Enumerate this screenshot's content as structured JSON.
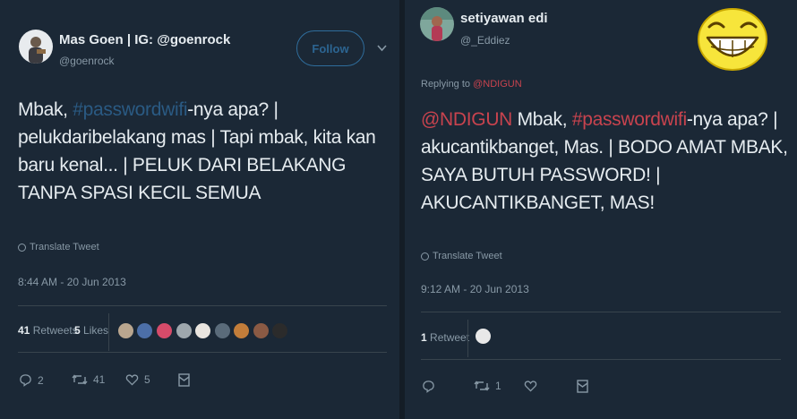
{
  "tweets": [
    {
      "name": "Mas Goen | IG: @goenrock",
      "handle": "@goenrock",
      "follow_label": "Follow",
      "text_part1": "Mbak, ",
      "hashtag": "#passwordwifi",
      "text_part2": "-nya apa? | pelukdaribelakang mas | Tapi mbak, kita kan baru kenal... | PELUK DARI BELAKANG TANPA SPASI KECIL SEMUA",
      "translate": "Translate Tweet",
      "timestamp": "8:44 AM - 20 Jun 2013",
      "retweets_count": "41",
      "retweets_label": "Retweets",
      "likes_count": "5",
      "likes_label": "Likes",
      "actions": {
        "reply": "2",
        "retweet": "41",
        "like": "5"
      }
    },
    {
      "name": "setiyawan edi",
      "handle": "@_Eddiez",
      "replying_prefix": "Replying to ",
      "replying_to": "@NDIGUN",
      "mention": "@NDIGUN",
      "text_part1": " Mbak, ",
      "hashtag": "#passwordwifi",
      "text_part2": "-nya apa? | akucantikbanget, Mas. | BODO AMAT MBAK, SAYA BUTUH PASSWORD! | AKUCANTIKBANGET, MAS!",
      "translate": "Translate Tweet",
      "timestamp": "9:12 AM - 20 Jun 2013",
      "retweets_count": "1",
      "retweets_label": "Retweet",
      "actions": {
        "reply": "",
        "retweet": "1",
        "like": ""
      }
    }
  ],
  "colors": {
    "background": "#141d26",
    "card": "#1b2836",
    "text": "#e6ecf0",
    "muted": "#8899a6",
    "hashtag_left": "#2a5a83",
    "mention_red": "#c8434e",
    "emoji_yellow": "#f7e53b"
  },
  "icons": [
    "translate-globe-icon",
    "reply-icon",
    "retweet-icon",
    "like-heart-icon",
    "dm-envelope-icon",
    "caret-down-icon",
    "laughing-emoji-icon"
  ]
}
